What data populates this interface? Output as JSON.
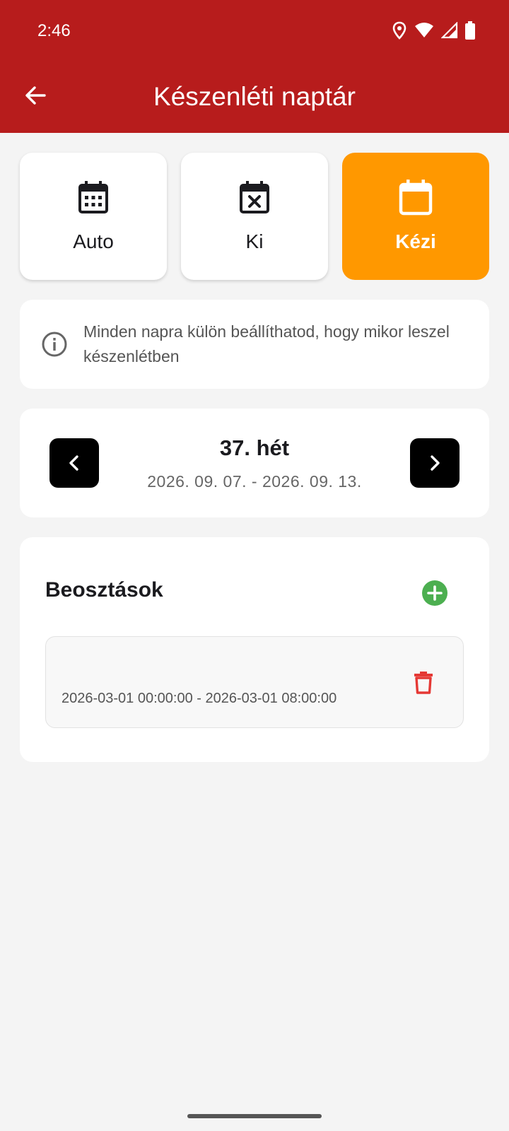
{
  "status_bar": {
    "time": "2:46",
    "icons": [
      "location-icon",
      "wifi-icon",
      "cellular-signal-icon",
      "battery-icon"
    ]
  },
  "app_bar": {
    "title": "Készenléti naptár",
    "back_icon": "arrow-back-icon",
    "background_color": "#b71c1c"
  },
  "modes": [
    {
      "label": "Auto",
      "icon": "calendar-month-icon",
      "selected": false
    },
    {
      "label": "Ki",
      "icon": "calendar-remove-icon",
      "selected": false
    },
    {
      "label": "Kézi",
      "icon": "calendar-blank-icon",
      "selected": true
    }
  ],
  "accent_color": "#ff9800",
  "info": {
    "icon": "info-outline-icon",
    "text": "Minden napra külön beállíthatod, hogy mikor leszel készenlétben"
  },
  "week": {
    "title": "37. hét",
    "range": "2026. 09. 07. - 2026. 09. 13.",
    "prev_icon": "chevron-left-icon",
    "next_icon": "chevron-right-icon"
  },
  "schedules": {
    "title": "Beosztások",
    "add_icon": "add-circle-icon",
    "add_color": "#4caf50",
    "delete_color": "#e53935",
    "items": [
      {
        "range": "2026-03-01 00:00:00 - 2026-03-01 08:00:00",
        "delete_icon": "trash-icon"
      }
    ]
  }
}
